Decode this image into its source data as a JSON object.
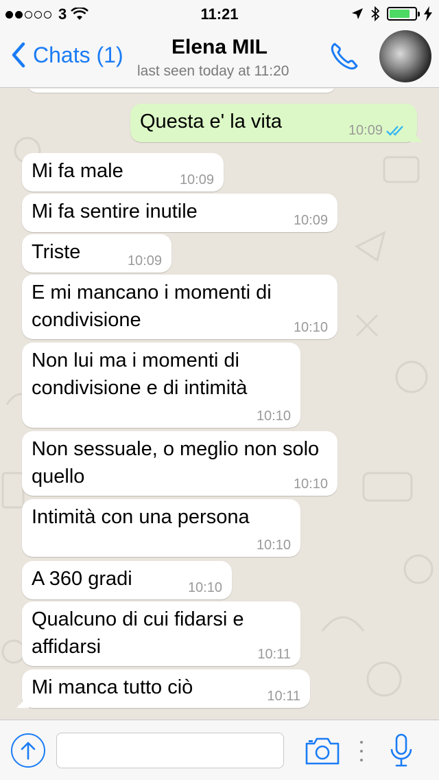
{
  "status_bar": {
    "carrier": "3",
    "time": "11:21"
  },
  "header": {
    "back_label": "Chats (1)",
    "contact_name": "Elena MIL",
    "contact_status": "last seen today at 11:20"
  },
  "messages": [
    {
      "text": "Questa e' la vita",
      "time": "10:09",
      "direction": "out",
      "status_icon": "double-check-icon"
    },
    {
      "text": "Mi fa male",
      "time": "10:09",
      "direction": "in"
    },
    {
      "text": "Mi fa sentire inutile",
      "time": "10:09",
      "direction": "in"
    },
    {
      "text": "Triste",
      "time": "10:09",
      "direction": "in"
    },
    {
      "text": "E mi mancano i momenti di condivisione",
      "time": "10:10",
      "direction": "in"
    },
    {
      "text": "Non lui ma i momenti di condivisione e di intimità",
      "time": "10:10",
      "direction": "in"
    },
    {
      "text": "Non sessuale, o meglio non solo quello",
      "time": "10:10",
      "direction": "in"
    },
    {
      "text": "Intimità con una persona",
      "time": "10:10",
      "direction": "in"
    },
    {
      "text": "A 360 gradi",
      "time": "10:10",
      "direction": "in"
    },
    {
      "text": "Qualcuno di cui fidarsi e affidarsi",
      "time": "10:11",
      "direction": "in"
    },
    {
      "text": "Mi manca tutto ciò",
      "time": "10:11",
      "direction": "in"
    }
  ],
  "input_bar": {
    "placeholder": ""
  },
  "colors": {
    "accent": "#1a7cf5",
    "outgoing_bubble": "#dcf8c6",
    "incoming_bubble": "#ffffff",
    "chat_background": "#e9e4dc",
    "battery": "#4cd964",
    "read_ticks": "#34b7f1"
  },
  "icons": [
    "signal-dots-icon",
    "wifi-icon",
    "location-arrow-icon",
    "bluetooth-icon",
    "battery-icon",
    "charging-bolt-icon",
    "back-chevron-icon",
    "phone-icon",
    "share-arrow-icon",
    "camera-icon",
    "microphone-icon"
  ],
  "status_indicators": {
    "signal_bars_filled": 2,
    "signal_bars_total": 5,
    "battery_level": 0.8
  }
}
